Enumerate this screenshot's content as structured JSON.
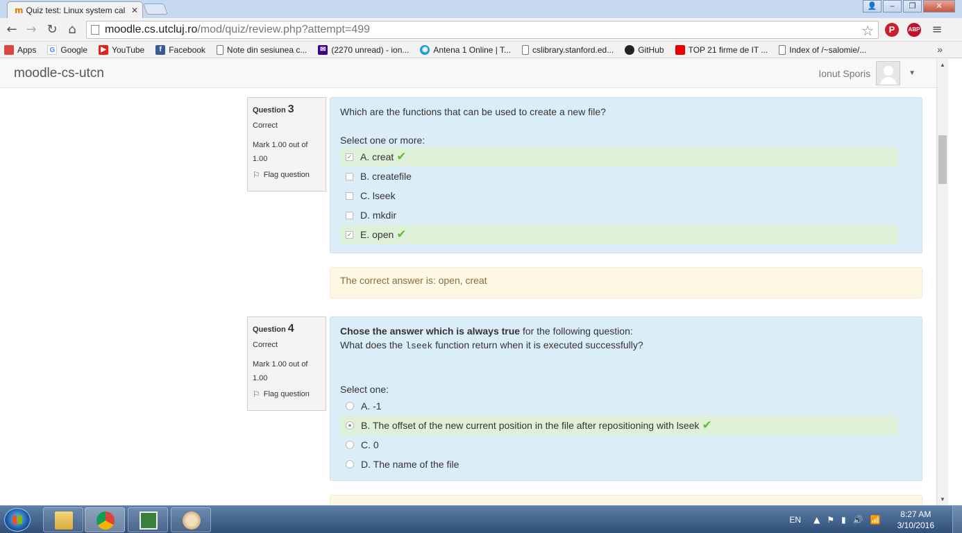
{
  "browser": {
    "tab_title": "Quiz test: Linux system cal",
    "url_host": "moodle.cs.utcluj.ro",
    "url_path": "/mod/quiz/review.php?attempt=499",
    "bookmarks": [
      {
        "label": "Apps",
        "icon": "apps-grid-icon",
        "color": "#d44"
      },
      {
        "label": "Google",
        "icon": "google-icon",
        "color": "#4285f4"
      },
      {
        "label": "YouTube",
        "icon": "youtube-icon",
        "color": "#e62117"
      },
      {
        "label": "Facebook",
        "icon": "facebook-icon",
        "color": "#3b5998"
      },
      {
        "label": "Note din sesiunea c...",
        "icon": "page-icon",
        "color": "#fff"
      },
      {
        "label": "(2270 unread) - ion...",
        "icon": "yahoo-mail-icon",
        "color": "#400090"
      },
      {
        "label": "Antena 1 Online | T...",
        "icon": "antena-icon",
        "color": "#1a9bd7"
      },
      {
        "label": "cslibrary.stanford.ed...",
        "icon": "page-icon",
        "color": "#fff"
      },
      {
        "label": "GitHub",
        "icon": "github-icon",
        "color": "#222"
      },
      {
        "label": "TOP 21 firme de IT ...",
        "icon": "flag-red-icon",
        "color": "#e00"
      },
      {
        "label": "Index of /~salomie/...",
        "icon": "page-icon",
        "color": "#fff"
      }
    ],
    "more": "»"
  },
  "site": {
    "brand": "moodle-cs-utcn",
    "user_name": "Ionut Sporis"
  },
  "questions": [
    {
      "label": "Question",
      "number": "3",
      "state": "Correct",
      "grade": "Mark 1.00 out of 1.00",
      "flag": "Flag question",
      "text": "Which are the functions that can be used to create a new file?",
      "prompt": "Select one or more:",
      "answers": [
        {
          "text": "A. creat",
          "checked": true,
          "correct": true
        },
        {
          "text": "B. createfile",
          "checked": false,
          "correct": false
        },
        {
          "text": "C. lseek",
          "checked": false,
          "correct": false
        },
        {
          "text": "D. mkdir",
          "checked": false,
          "correct": false
        },
        {
          "text": "E. open",
          "checked": true,
          "correct": true
        }
      ],
      "feedback": "The correct answer is: open, creat"
    },
    {
      "label": "Question",
      "number": "4",
      "state": "Correct",
      "grade": "Mark 1.00 out of 1.00",
      "flag": "Flag question",
      "text_bold": "Chose the answer which is always true",
      "text_rest": " for the following question:",
      "text_line2_pre": "What does the ",
      "text_line2_code": "lseek",
      "text_line2_post": " function return when it is executed successfully?",
      "prompt": "Select one:",
      "answers": [
        {
          "text": "A. -1",
          "checked": false,
          "correct": false
        },
        {
          "text": "B. The offset of the new current position in the file after repositioning with lseek",
          "checked": true,
          "correct": true
        },
        {
          "text": "C. 0",
          "checked": false,
          "correct": false
        },
        {
          "text": "D. The name of the file",
          "checked": false,
          "correct": false
        }
      ]
    }
  ],
  "taskbar": {
    "lang": "EN",
    "time": "8:27 AM",
    "date": "3/10/2016"
  }
}
